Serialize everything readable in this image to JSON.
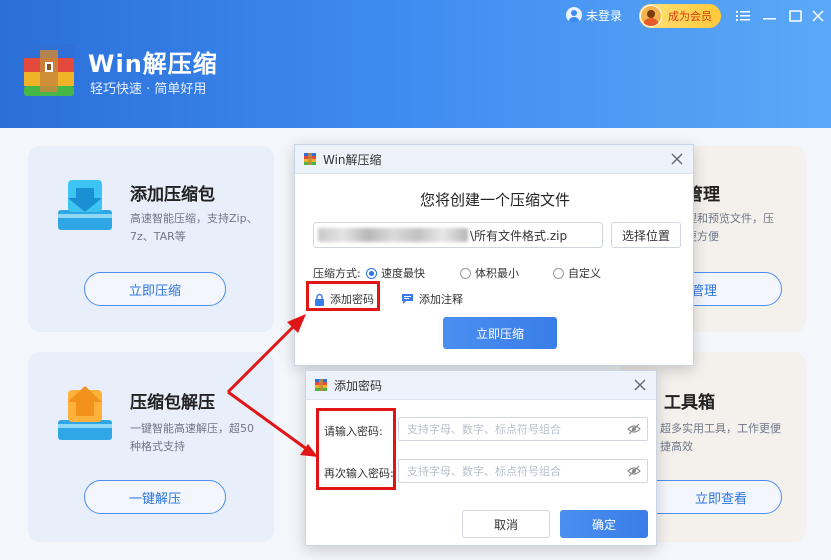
{
  "header": {
    "app_name": "Win解压缩",
    "slogan": "轻巧快速 · 简单好用",
    "login_label": "未登录",
    "vip_label": "成为会员"
  },
  "cards": {
    "compress": {
      "title": "添加压缩包",
      "desc_line1": "高速智能压缩，支持Zip、",
      "desc_line2": "7z、TAR等",
      "button": "立即压缩"
    },
    "extract": {
      "title": "压缩包解压",
      "desc_line1": "一键智能高速解压，超50",
      "desc_line2": "种格式支持",
      "button": "一键解压"
    },
    "manage": {
      "title": "管理",
      "desc_line1": "理和预览文件，压",
      "desc_line2": "更方便",
      "button": "管理"
    },
    "toolbox": {
      "title": "工具箱",
      "desc_line1": "超多实用工具，工作更便",
      "desc_line2": "捷高效",
      "button": "立即查看"
    }
  },
  "compress_dialog": {
    "title": "Win解压缩",
    "heading": "您将创建一个压缩文件",
    "path_suffix": "\\所有文件格式.zip",
    "choose_location": "选择位置",
    "method_label": "压缩方式:",
    "options": [
      "速度最快",
      "体积最小",
      "自定义"
    ],
    "selected_option": "速度最快",
    "add_password": "添加密码",
    "add_comment": "添加注释",
    "submit": "立即压缩"
  },
  "password_dialog": {
    "title": "添加密码",
    "password_label": "请输入密码:",
    "confirm_label": "再次输入密码:",
    "placeholder": "支持字母、数字、标点符号组合",
    "cancel": "取消",
    "ok": "确定"
  },
  "colors": {
    "brand_blue": "#3d8af0",
    "highlight_red": "#e01515",
    "vip_gold": "#ffc93a"
  }
}
